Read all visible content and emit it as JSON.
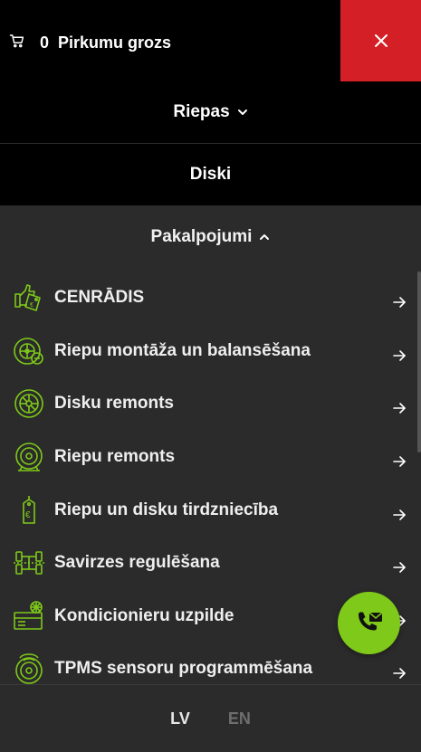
{
  "header": {
    "cart_count": "0",
    "cart_label": "Pirkumu grozs",
    "close_color": "#d41f26"
  },
  "nav": {
    "riepas": "Riepas",
    "diski": "Diski",
    "pakalpojumi": "Pakalpojumi"
  },
  "services": [
    {
      "label": "CENRĀDIS",
      "icon": "price-tag-hand-icon"
    },
    {
      "label": "Riepu montāža un balansēšana",
      "icon": "tire-mounting-icon"
    },
    {
      "label": "Disku remonts",
      "icon": "wheel-rim-icon"
    },
    {
      "label": "Riepu remonts",
      "icon": "tire-repair-icon"
    },
    {
      "label": "Riepu un disku tirdzniecība",
      "icon": "euro-tag-icon"
    },
    {
      "label": "Savirzes regulēšana",
      "icon": "alignment-icon"
    },
    {
      "label": "Kondicionieru uzpilde",
      "icon": "ac-refill-icon"
    },
    {
      "label": "TPMS sensoru programmēšana",
      "icon": "tpms-sensor-icon"
    }
  ],
  "languages": {
    "lv": "LV",
    "en": "EN"
  },
  "colors": {
    "accent": "#7ec919",
    "background": "#2b2b2b",
    "nav_bg": "#000000"
  }
}
